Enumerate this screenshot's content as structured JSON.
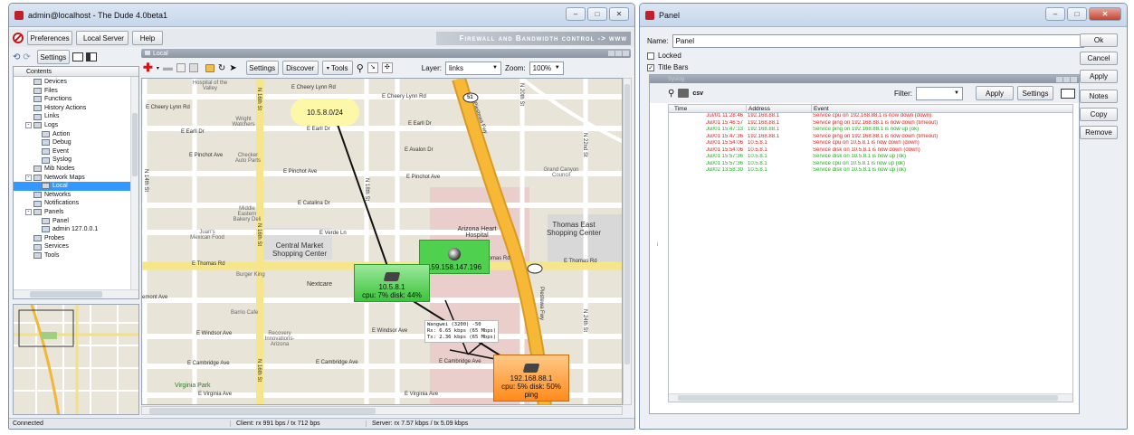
{
  "dude_window": {
    "title": "admin@localhost - The Dude 4.0beta1",
    "toolbar": {
      "preferences": "Preferences",
      "local_server": "Local Server",
      "help": "Help",
      "brand": "Firewall and Bandwidth control -> www"
    },
    "left_toolbar": {
      "settings": "Settings"
    },
    "contents_header": "Contents",
    "tree": [
      {
        "label": "Devices",
        "indent": 2
      },
      {
        "label": "Files",
        "indent": 2
      },
      {
        "label": "Functions",
        "indent": 2
      },
      {
        "label": "History Actions",
        "indent": 2
      },
      {
        "label": "Links",
        "indent": 2
      },
      {
        "label": "Logs",
        "indent": 1,
        "expander": "-"
      },
      {
        "label": "Action",
        "indent": 3
      },
      {
        "label": "Debug",
        "indent": 3
      },
      {
        "label": "Event",
        "indent": 3
      },
      {
        "label": "Syslog",
        "indent": 3
      },
      {
        "label": "Mib Nodes",
        "indent": 2
      },
      {
        "label": "Network Maps",
        "indent": 1,
        "expander": "-"
      },
      {
        "label": "Local",
        "indent": 3,
        "selected": true
      },
      {
        "label": "Networks",
        "indent": 2
      },
      {
        "label": "Notifications",
        "indent": 2
      },
      {
        "label": "Panels",
        "indent": 1,
        "expander": "-"
      },
      {
        "label": "Panel",
        "indent": 3
      },
      {
        "label": "admin 127.0.0.1",
        "indent": 3
      },
      {
        "label": "Probes",
        "indent": 2
      },
      {
        "label": "Services",
        "indent": 2
      },
      {
        "label": "Tools",
        "indent": 2
      }
    ],
    "map_tab": "Local",
    "map_toolbar": {
      "settings": "Settings",
      "discover": "Discover",
      "tools": "Tools",
      "layer_label": "Layer:",
      "layer_value": "links",
      "zoom_label": "Zoom:",
      "zoom_value": "100%"
    },
    "map": {
      "cloud": "10.5.8.0/24",
      "device_a": {
        "ip": "159.158.147.196"
      },
      "device_b": {
        "ip": "10.5.8.1",
        "stats": "cpu: 7% disk: 44%"
      },
      "device_c": {
        "ip": "192.168.88.1",
        "stats": "cpu: 5% disk: 50%",
        "status": "ping"
      },
      "link_label": [
        "Wangwei (3200) -50",
        "Rx: 6.65 kbps (65 Mbps)",
        "Tx: 2.36 kbps (65 Mbps)"
      ],
      "places": {
        "hospital": "Hospital of the Valley",
        "wright": "Wright Watchers",
        "checker": "Checker Auto Parts",
        "middle_eastern": "Middle Eastern Bakery Deli",
        "juans": "Juan's Mexican Food",
        "central_market": "Central Market Shopping Center",
        "arizona_heart": "Arizona Heart Hospital",
        "thomas_east": "Thomas East Shopping Center",
        "grand_canyon": "Grand Canyon Council",
        "burger_king": "Burger King",
        "nextcare": "Nextcare",
        "barrio_cafe": "Barrio Cafe",
        "recovery": "Recovery Innovations-Arizona",
        "virginia_park": "Virginia Park"
      },
      "streets": {
        "cheery_lynn_1": "E Cheery Lynn Rd",
        "cheery_lynn_2": "E Cheery Lynn Rd",
        "cheery_lynn_3": "E Cheery Lynn Rd",
        "earll_1": "E Earll Dr",
        "earll_2": "E Earll Dr",
        "earll_3": "E Earll Dr",
        "avalon": "E Avalon Dr",
        "pinchot_1": "E Pinchot Ave",
        "pinchot_2": "E Pinchot Ave",
        "pinchot_3": "E Pinchot Ave",
        "catalina": "E Catalina Dr",
        "verde": "E Verde Ln",
        "thomas_1": "E Thomas Rd",
        "thomas_2": "E Thomas Rd",
        "thomas_3": "E Thomas Rd",
        "osborn": "emont Ave",
        "windsor_1": "E Windsor Ave",
        "windsor_2": "E Windsor Ave",
        "cambridge_1": "E Cambridge Ave",
        "cambridge_2": "E Cambridge Ave",
        "cambridge_3": "E Cambridge Ave",
        "virginia_1": "E Virginia Ave",
        "virginia_2": "E Virginia Ave",
        "st16_1": "N 16th St",
        "st16_2": "N 16th St",
        "st16_3": "N 16th St",
        "st18": "N 18th St",
        "st20": "N 20th St",
        "st14": "N 14th St",
        "pwy": "Piestewa Fwy",
        "pwy2": "Piestewa Fwy",
        "st22": "N 22nd St",
        "st24": "N 24th St",
        "hwy": "51"
      }
    },
    "status": {
      "connected": "Connected",
      "client": "Client: rx 991 bps / tx 712 bps",
      "server": "Server: rx 7.57 kbps / tx 5.09 kbps"
    }
  },
  "panel_window": {
    "title": "Panel",
    "name_label": "Name:",
    "name_value": "Panel",
    "locked": "Locked",
    "title_bars": "Title Bars",
    "buttons": [
      "Ok",
      "Cancel",
      "Apply",
      "Notes",
      "Copy",
      "Remove"
    ],
    "inner_title": "Syslog",
    "filter_label": "Filter:",
    "apply": "Apply",
    "settings": "Settings",
    "csv": "csv",
    "columns": [
      "Time",
      "Address",
      "Event"
    ],
    "events": [
      {
        "time": "Jul/01 11:28:46",
        "address": "192.168.88.1",
        "event": "Service cpu on 192.168.88.1 is now down (down)",
        "status": "down"
      },
      {
        "time": "Jul/01 15:46:57",
        "address": "192.168.88.1",
        "event": "Service ping on 192.168.88.1 is now down (timeout)",
        "status": "down"
      },
      {
        "time": "Jul/01 15:47:13",
        "address": "192.168.88.1",
        "event": "Service ping on 192.168.88.1 is now up (ok)",
        "status": "up"
      },
      {
        "time": "Jul/01 15:47:36",
        "address": "192.168.88.1",
        "event": "Service ping on 192.168.88.1 is now down (timeout)",
        "status": "down"
      },
      {
        "time": "Jul/01 15:54:06",
        "address": "10.5.8.1",
        "event": "Service cpu on 10.5.8.1 is now down (down)",
        "status": "down"
      },
      {
        "time": "Jul/01 15:54:06",
        "address": "10.5.8.1",
        "event": "Service disk on 10.5.8.1 is now down (down)",
        "status": "down"
      },
      {
        "time": "Jul/01 15:57:36",
        "address": "10.5.8.1",
        "event": "Service disk on 10.5.8.1 is now up (ok)",
        "status": "up"
      },
      {
        "time": "Jul/01 15:57:36",
        "address": "10.5.8.1",
        "event": "Service cpu on 10.5.8.1 is now up (ok)",
        "status": "up"
      },
      {
        "time": "Jul/02 13:58:30",
        "address": "10.5.8.1",
        "event": "Service disk on 10.5.8.1 is now up (ok)",
        "status": "up"
      }
    ]
  },
  "colors": {
    "down": "#e02020",
    "up": "#1bb01b",
    "selected": "#3399ff"
  }
}
